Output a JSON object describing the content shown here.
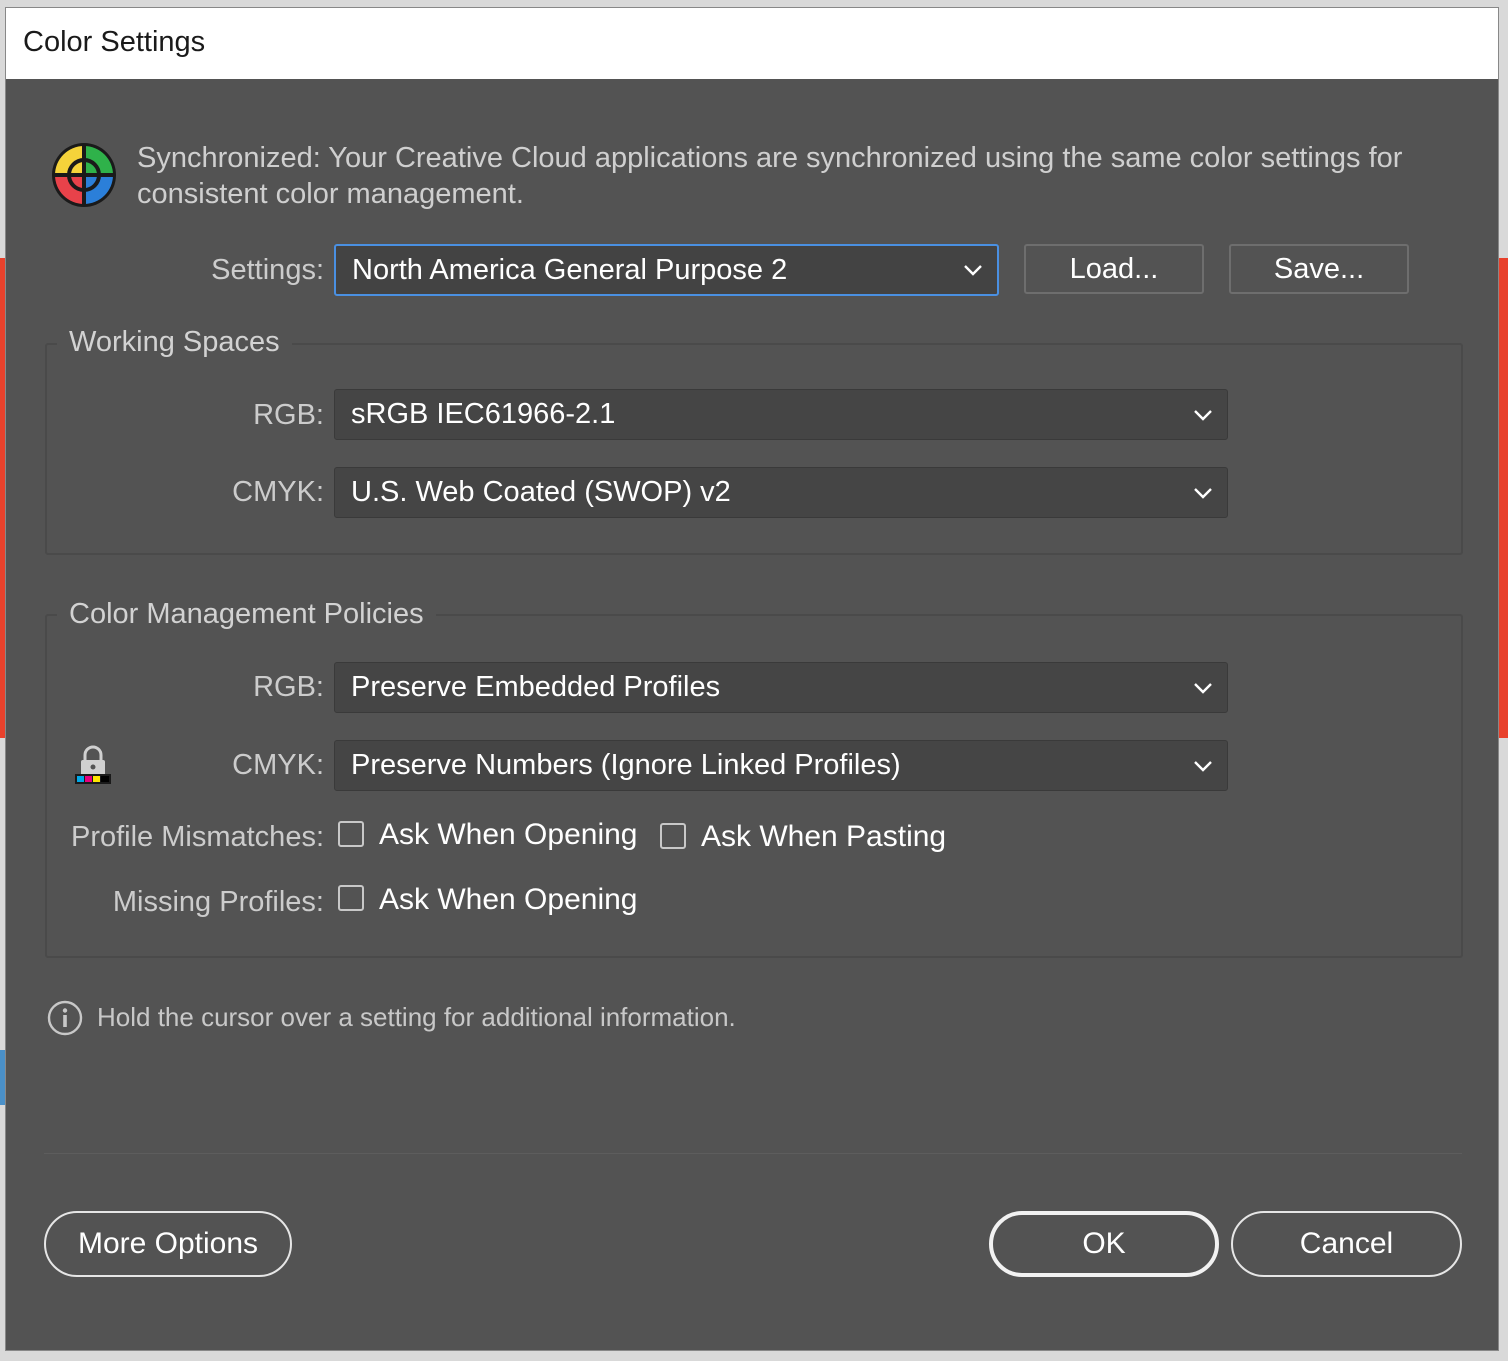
{
  "window": {
    "title": "Color Settings"
  },
  "sync": {
    "text": "Synchronized: Your Creative Cloud applications are synchronized using the same color settings for consistent color management."
  },
  "settings": {
    "label": "Settings:",
    "value": "North America General Purpose 2",
    "load_label": "Load...",
    "save_label": "Save..."
  },
  "working_spaces": {
    "title": "Working Spaces",
    "rgb_label": "RGB:",
    "rgb_value": "sRGB IEC61966-2.1",
    "cmyk_label": "CMYK:",
    "cmyk_value": "U.S. Web Coated (SWOP) v2"
  },
  "policies": {
    "title": "Color Management Policies",
    "rgb_label": "RGB:",
    "rgb_value": "Preserve Embedded Profiles",
    "cmyk_label": "CMYK:",
    "cmyk_value": "Preserve Numbers (Ignore Linked Profiles)",
    "mismatch_label": "Profile Mismatches:",
    "mismatch_opening": "Ask When Opening",
    "mismatch_pasting": "Ask When Pasting",
    "missing_label": "Missing Profiles:",
    "missing_opening": "Ask When Opening",
    "checked": {
      "mismatch_opening": false,
      "mismatch_pasting": false,
      "missing_opening": false
    }
  },
  "info": {
    "text": "Hold the cursor over a setting for additional information."
  },
  "footer": {
    "more_options_label": "More Options",
    "ok_label": "OK",
    "cancel_label": "Cancel"
  },
  "colors": {
    "dialog_bg": "#535353",
    "focus_accent": "#4a90e2",
    "background_accent": "#e8412c"
  }
}
